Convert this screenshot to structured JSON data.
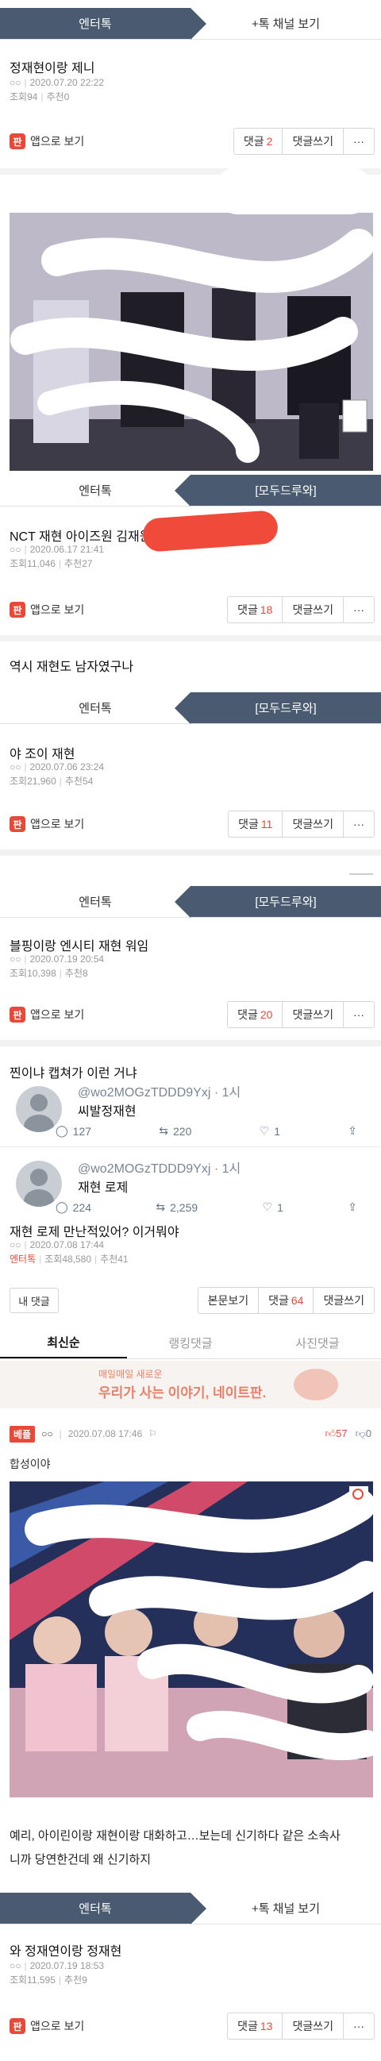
{
  "section1": {
    "tab_left": "엔터톡",
    "tab_right": "+톡 채널 보기",
    "title": "정재현이랑 제니",
    "meta_name": "○○",
    "meta_time": "2020.07.20 22:22",
    "meta_views": "조회94",
    "meta_recommend": "추천0",
    "app_label": "앱으로 보기",
    "comment_label": "댓글",
    "comment_count": "2",
    "write_label": "댓글쓰기",
    "more_label": "···"
  },
  "section2": {
    "tab_left": "엔터톡",
    "tab_right": "[모두드루와]",
    "title": "NCT 재현 아이즈원 김재원",
    "meta_name": "○○",
    "meta_time": "2020.06.17 21:41",
    "meta_views": "조회11,046",
    "meta_recommend": "추천27",
    "app_label": "앱으로 보기",
    "comment_label": "댓글",
    "comment_count": "18",
    "write_label": "댓글쓰기",
    "more_label": "···"
  },
  "caption1": "역시 재현도 남자였구나",
  "section3": {
    "tab_left": "엔터톡",
    "tab_right": "[모두드루와]",
    "title": "야 조이 재현",
    "meta_name": "○○",
    "meta_time": "2020.07.06 23:24",
    "meta_views": "조회21,960",
    "meta_recommend": "추천54",
    "app_label": "앱으로 보기",
    "comment_label": "댓글",
    "comment_count": "11",
    "write_label": "댓글쓰기",
    "more_label": "···"
  },
  "section4": {
    "tab_left": "엔터톡",
    "tab_right": "[모두드루와]",
    "title": "블핑이랑 엔시티 재현 워임",
    "meta_name": "○○",
    "meta_time": "2020.07.19 20:54",
    "meta_views": "조회10,398",
    "meta_recommend": "추천8",
    "app_label": "앱으로 보기",
    "comment_label": "댓글",
    "comment_count": "20",
    "write_label": "댓글쓰기",
    "more_label": "···"
  },
  "caption2": "찐이냐 캡쳐가 이런 거냐",
  "tweets": [
    {
      "handle": "@wo2MOGzTDDD9Yxj · 1시",
      "text": "씨발정재현",
      "replies": "127",
      "retweets": "220",
      "likes": "1"
    },
    {
      "handle": "@wo2MOGzTDDD9Yxj · 1시",
      "text": "재현 로제",
      "replies": "224",
      "retweets": "2,259",
      "likes": "1"
    }
  ],
  "section5": {
    "title": "재현 로제 만난적있어? 이거뭐야",
    "meta_name": "○○",
    "meta_time": "2020.07.08 17:44",
    "meta_board": "엔터톡",
    "meta_views": "조회48,580",
    "meta_recommend": "추천41",
    "my_comment": "내 댓글",
    "view_post": "본문보기",
    "comment_label": "댓글",
    "comment_count": "64",
    "write_label": "댓글쓰기"
  },
  "comment_tabs": [
    "최신순",
    "랭킹댓글",
    "사진댓글"
  ],
  "banner": {
    "small": "매일매일 새로운",
    "big": "우리가 사는 이야기, 네이트판."
  },
  "comment": {
    "badge": "베플",
    "name": "○○",
    "time": "2020.07.08 17:46",
    "likes": "57",
    "dislikes": "0",
    "text": "합성이야"
  },
  "caption3_line1": "예리, 아이린이랑 재현이랑 대화하고…보는데 신기하다 같은 소속사",
  "caption3_line2": "니까 당연한건데 왜 신기하지",
  "section6": {
    "tab_left": "엔터톡",
    "tab_right": "+톡 채널 보기",
    "title": "와 정재연이랑 정재현",
    "meta_name": "○○",
    "meta_time": "2020.07.19 18:53",
    "meta_views": "조회11,595",
    "meta_recommend": "추천9",
    "app_label": "앱으로 보기",
    "comment_label": "댓글",
    "comment_count": "13",
    "write_label": "댓글쓰기",
    "more_label": "···"
  },
  "colors": {
    "tab_dark": "#4a5a70",
    "accent_red": "#e84a3a"
  }
}
